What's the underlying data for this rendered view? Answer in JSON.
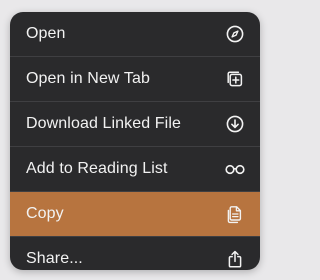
{
  "menu": {
    "items": [
      {
        "label": "Open",
        "icon": "compass-icon"
      },
      {
        "label": "Open in New Tab",
        "icon": "new-tab-icon"
      },
      {
        "label": "Download Linked File",
        "icon": "download-circle-icon"
      },
      {
        "label": "Add to Reading List",
        "icon": "glasses-icon"
      },
      {
        "label": "Copy",
        "icon": "copy-documents-icon",
        "highlighted": true
      },
      {
        "label": "Share...",
        "icon": "share-icon"
      }
    ],
    "highlight_color": "#b7743f",
    "background_color": "#2a2a2c",
    "text_color": "#f2f2f2"
  }
}
